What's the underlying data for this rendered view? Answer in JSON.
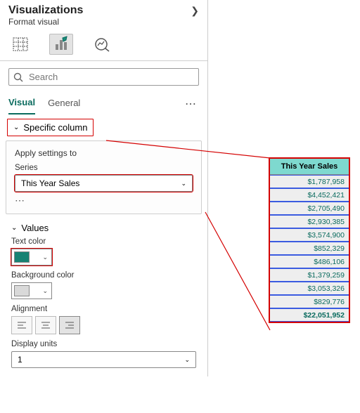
{
  "header": {
    "title": "Visualizations",
    "subtitle": "Format visual"
  },
  "search": {
    "placeholder": "Search"
  },
  "tabs": {
    "visual": "Visual",
    "general": "General"
  },
  "specific_column": {
    "label": "Specific column"
  },
  "apply": {
    "title": "Apply settings to",
    "series_label": "Series",
    "series_value": "This Year Sales"
  },
  "values": {
    "title": "Values",
    "text_color_label": "Text color",
    "text_color": "#188273",
    "bg_color_label": "Background color",
    "bg_color": "#d9d9d9",
    "alignment_label": "Alignment",
    "display_units_label": "Display units",
    "display_units_value": "1"
  },
  "preview": {
    "header": "This Year Sales",
    "rows": [
      "$1,787,958",
      "$4,452,421",
      "$2,705,490",
      "$2,930,385",
      "$3,574,900",
      "$852,329",
      "$486,106",
      "$1,379,259",
      "$3,053,326",
      "$829,776"
    ],
    "total": "$22,051,952"
  }
}
